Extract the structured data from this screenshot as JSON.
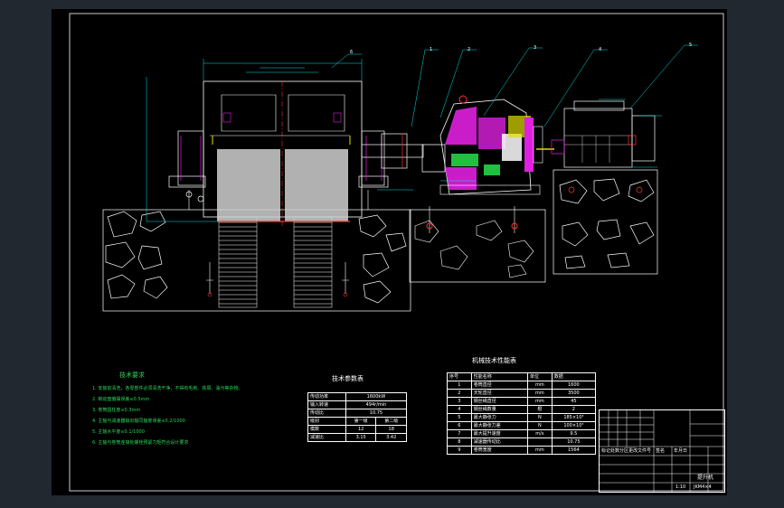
{
  "tech_requirements": {
    "title": "技术要求",
    "items": [
      "1. 安装前清洗，各零部件必须清洗干净，不得有毛刺、铁屑、油污等杂物。",
      "2. 制动盘偏摆误差≤0.5mm",
      "3. 卷筒圆柱度≤0.3mm",
      "4. 主轴与减速器输出轴同轴度误差≤0.2/1000",
      "5. 主轴水平度≤0.1/1000",
      "6. 主轴与卷筒连接处螺栓预紧力矩符合设计要求"
    ]
  },
  "tech_params": {
    "title": "技术参数表",
    "rows": [
      {
        "k": "传动功率",
        "v": "1600kW"
      },
      {
        "k": "输入转速",
        "v": "494r/min"
      },
      {
        "k": "传动比",
        "v": "10.75"
      }
    ],
    "stage_header": [
      "级别",
      "第一级",
      "第二级"
    ],
    "stage_rows": [
      {
        "k": "模数",
        "a": "12",
        "b": "18"
      },
      {
        "k": "减速比",
        "a": "3.15",
        "b": "3.42"
      }
    ]
  },
  "machine_perf": {
    "title": "机械技术性能表",
    "header": [
      "序号",
      "性能名称",
      "单位",
      "数据"
    ],
    "rows": [
      [
        "1",
        "卷筒直径",
        "mm",
        "1600"
      ],
      [
        "2",
        "天轮直径",
        "mm",
        "3500"
      ],
      [
        "3",
        "钢丝绳直径",
        "mm",
        "45"
      ],
      [
        "4",
        "钢丝绳数量",
        "根",
        "2"
      ],
      [
        "5",
        "最大静张力",
        "N",
        "185×10³"
      ],
      [
        "6",
        "最大静张力差",
        "N",
        "100×10³"
      ],
      [
        "7",
        "最大提升速度",
        "m/s",
        "9.5"
      ],
      [
        "8",
        "减速器传动比",
        "",
        "10.75"
      ],
      [
        "9",
        "卷筒宽度",
        "mm",
        "1564"
      ]
    ]
  },
  "title_block": {
    "drawing_name": "提升机",
    "code": "JKM4×4",
    "scale": "1:10",
    "row_labels": [
      "标记",
      "处数",
      "分区",
      "更改文件号",
      "签名",
      "年月日"
    ]
  },
  "balloons": [
    "1",
    "2",
    "3",
    "4",
    "5",
    "6"
  ],
  "colors": {
    "line": "#ffffff",
    "dim": "#00e0e0",
    "hatch_magenta": "#e020e0",
    "hatch_green": "#20c040",
    "red": "#ff3030",
    "yellow": "#e0e000"
  }
}
